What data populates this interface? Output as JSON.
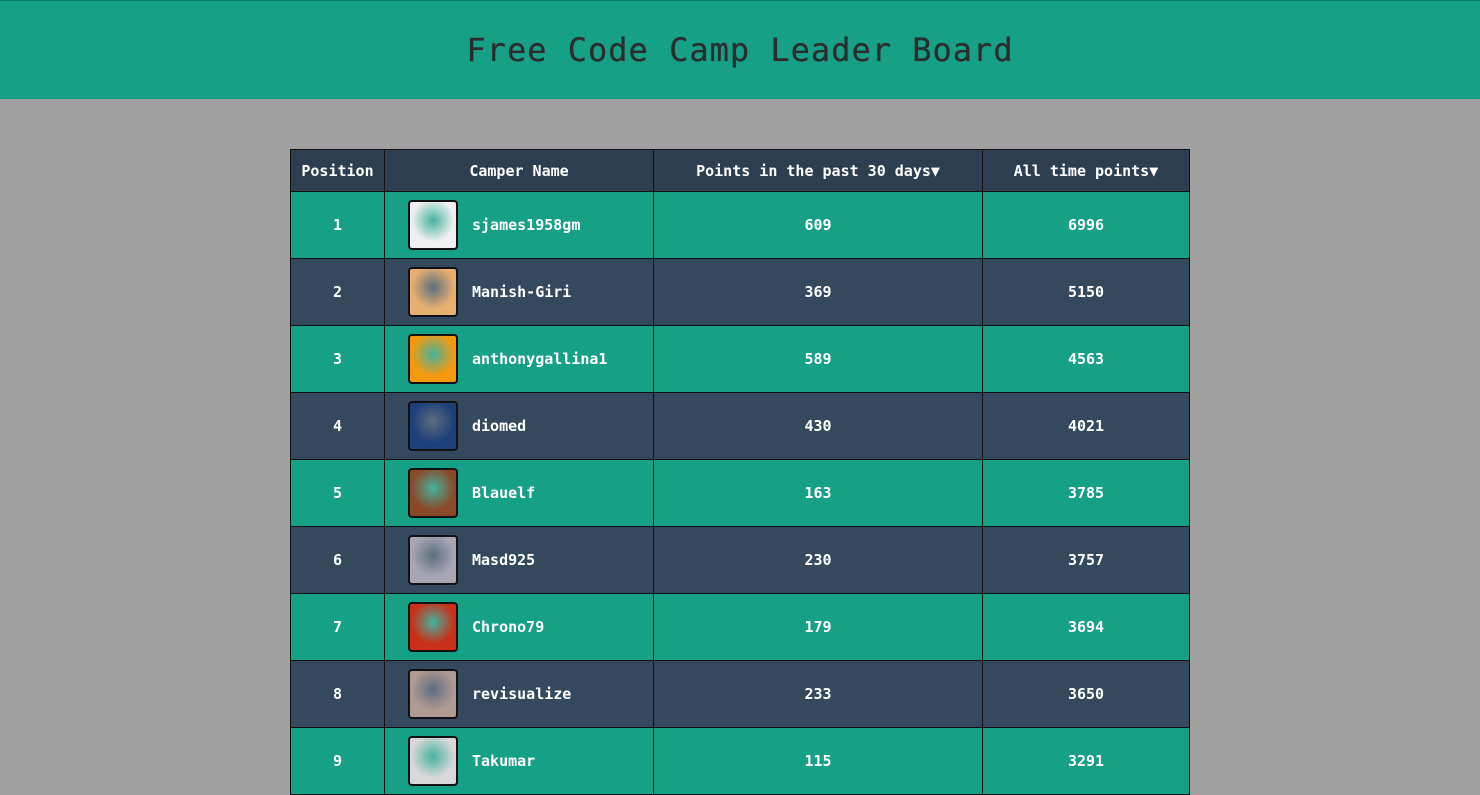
{
  "header": {
    "title": "Free Code Camp Leader Board"
  },
  "table": {
    "columns": [
      "Position",
      "Camper Name",
      "Points in the past 30 days▼",
      "All time points▼"
    ],
    "rows": [
      {
        "position": "1",
        "name": "sjames1958gm",
        "recent": "609",
        "alltime": "6996",
        "avatar_color": "#f0f0f0"
      },
      {
        "position": "2",
        "name": "Manish-Giri",
        "recent": "369",
        "alltime": "5150",
        "avatar_color": "#e8b070"
      },
      {
        "position": "3",
        "name": "anthonygallina1",
        "recent": "589",
        "alltime": "4563",
        "avatar_color": "#f59a10"
      },
      {
        "position": "4",
        "name": "diomed",
        "recent": "430",
        "alltime": "4021",
        "avatar_color": "#1d3f7a"
      },
      {
        "position": "5",
        "name": "Blauelf",
        "recent": "163",
        "alltime": "3785",
        "avatar_color": "#8a4a2a"
      },
      {
        "position": "6",
        "name": "Masd925",
        "recent": "230",
        "alltime": "3757",
        "avatar_color": "#a9a6b4"
      },
      {
        "position": "7",
        "name": "Chrono79",
        "recent": "179",
        "alltime": "3694",
        "avatar_color": "#c8301a"
      },
      {
        "position": "8",
        "name": "revisualize",
        "recent": "233",
        "alltime": "3650",
        "avatar_color": "#b09a94"
      },
      {
        "position": "9",
        "name": "Takumar",
        "recent": "115",
        "alltime": "3291",
        "avatar_color": "#d8d8d8"
      }
    ]
  }
}
